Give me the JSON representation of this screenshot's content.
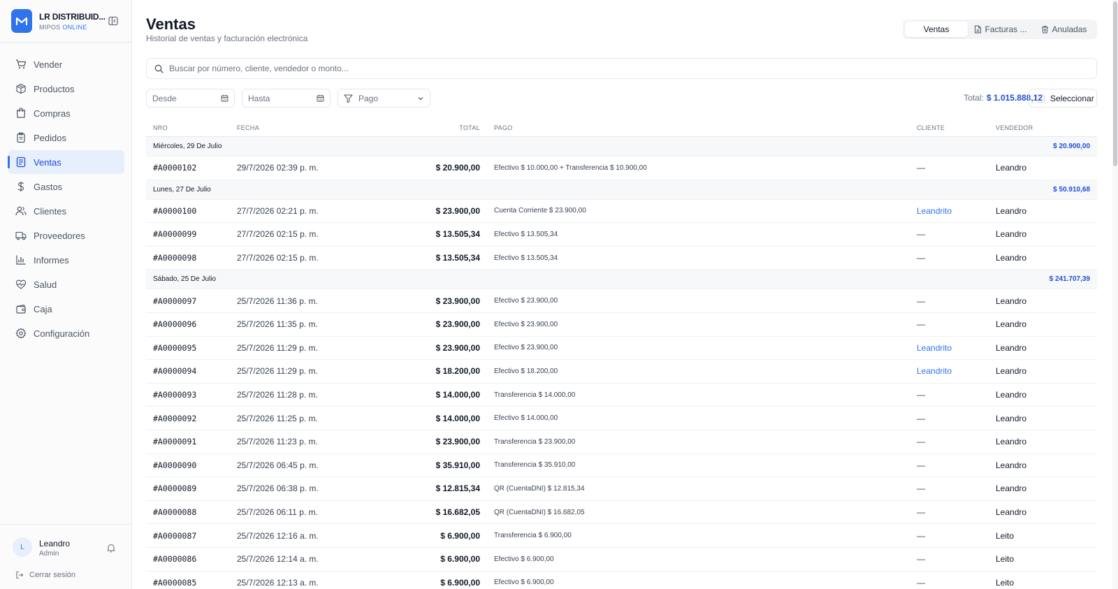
{
  "brand": {
    "name": "LR DISTRIBUID...",
    "sub_prefix": "MIPOS",
    "sub_accent": "ONLINE"
  },
  "colors": {
    "accent": "#2f74eb",
    "active_bg": "#e7eefc",
    "link": "#2f74eb"
  },
  "nav": [
    {
      "label": "Vender",
      "icon": "cart-icon"
    },
    {
      "label": "Productos",
      "icon": "box-icon"
    },
    {
      "label": "Compras",
      "icon": "bag-icon"
    },
    {
      "label": "Pedidos",
      "icon": "clipboard-icon"
    },
    {
      "label": "Ventas",
      "icon": "receipt-icon",
      "active": true
    },
    {
      "label": "Gastos",
      "icon": "dollar-icon"
    },
    {
      "label": "Clientes",
      "icon": "users-icon"
    },
    {
      "label": "Proveedores",
      "icon": "truck-icon"
    },
    {
      "label": "Informes",
      "icon": "bar-chart-icon"
    },
    {
      "label": "Salud",
      "icon": "heart-pulse-icon"
    },
    {
      "label": "Caja",
      "icon": "wallet-icon"
    },
    {
      "label": "Configuración",
      "icon": "gear-icon"
    }
  ],
  "user": {
    "initial": "L",
    "name": "Leandro",
    "role": "Admin",
    "logout": "Cerrar sesión"
  },
  "page": {
    "title": "Ventas",
    "subtitle": "Historial de ventas y facturación electrónica"
  },
  "tabs": {
    "ventas": "Ventas",
    "facturas": "Facturas ...",
    "anuladas": "Anuladas"
  },
  "search": {
    "placeholder": "Buscar por número, cliente, vendedor o monto..."
  },
  "filters": {
    "desde": "Desde",
    "hasta": "Hasta",
    "pago": "Pago"
  },
  "summary": {
    "total_label": "Total:",
    "total_value": "$ 1.015.888,12",
    "select_label": "Seleccionar"
  },
  "columns": {
    "nro": "NRO",
    "fecha": "FECHA",
    "total": "TOTAL",
    "pago": "PAGO",
    "cliente": "CLIENTE",
    "vendedor": "VENDEDOR"
  },
  "groups": [
    {
      "date": "Miércoles, 29 De Julio",
      "total": "$ 20.900,00",
      "rows": [
        {
          "nro": "#A0000102",
          "fecha": "29/7/2026 02:39 p. m.",
          "total": "$ 20.900,00",
          "pago": "Efectivo $ 10.000,00 + Transferencia $ 10.900,00",
          "cliente": "—",
          "vendedor": "Leandro"
        }
      ]
    },
    {
      "date": "Lunes, 27 De Julio",
      "total": "$ 50.910,68",
      "rows": [
        {
          "nro": "#A0000100",
          "fecha": "27/7/2026 02:21 p. m.",
          "total": "$ 23.900,00",
          "pago": "Cuenta Corriente $ 23.900,00",
          "cliente": "Leandrito",
          "vendedor": "Leandro"
        },
        {
          "nro": "#A0000099",
          "fecha": "27/7/2026 02:15 p. m.",
          "total": "$ 13.505,34",
          "pago": "Efectivo $ 13.505,34",
          "cliente": "—",
          "vendedor": "Leandro"
        },
        {
          "nro": "#A0000098",
          "fecha": "27/7/2026 02:15 p. m.",
          "total": "$ 13.505,34",
          "pago": "Efectivo $ 13.505,34",
          "cliente": "—",
          "vendedor": "Leandro"
        }
      ]
    },
    {
      "date": "Sábado, 25 De Julio",
      "total": "$ 241.707,39",
      "rows": [
        {
          "nro": "#A0000097",
          "fecha": "25/7/2026 11:36 p. m.",
          "total": "$ 23.900,00",
          "pago": "Efectivo $ 23.900,00",
          "cliente": "—",
          "vendedor": "Leandro"
        },
        {
          "nro": "#A0000096",
          "fecha": "25/7/2026 11:35 p. m.",
          "total": "$ 23.900,00",
          "pago": "Efectivo $ 23.900,00",
          "cliente": "—",
          "vendedor": "Leandro"
        },
        {
          "nro": "#A0000095",
          "fecha": "25/7/2026 11:29 p. m.",
          "total": "$ 23.900,00",
          "pago": "Efectivo $ 23.900,00",
          "cliente": "Leandrito",
          "vendedor": "Leandro"
        },
        {
          "nro": "#A0000094",
          "fecha": "25/7/2026 11:29 p. m.",
          "total": "$ 18.200,00",
          "pago": "Efectivo $ 18.200,00",
          "cliente": "Leandrito",
          "vendedor": "Leandro"
        },
        {
          "nro": "#A0000093",
          "fecha": "25/7/2026 11:28 p. m.",
          "total": "$ 14.000,00",
          "pago": "Transferencia $ 14.000,00",
          "cliente": "—",
          "vendedor": "Leandro"
        },
        {
          "nro": "#A0000092",
          "fecha": "25/7/2026 11:25 p. m.",
          "total": "$ 14.000,00",
          "pago": "Efectivo $ 14.000,00",
          "cliente": "—",
          "vendedor": "Leandro"
        },
        {
          "nro": "#A0000091",
          "fecha": "25/7/2026 11:23 p. m.",
          "total": "$ 23.900,00",
          "pago": "Transferencia $ 23.900,00",
          "cliente": "—",
          "vendedor": "Leandro"
        },
        {
          "nro": "#A0000090",
          "fecha": "25/7/2026 06:45 p. m.",
          "total": "$ 35.910,00",
          "pago": "Transferencia $ 35.910,00",
          "cliente": "—",
          "vendedor": "Leandro"
        },
        {
          "nro": "#A0000089",
          "fecha": "25/7/2026 06:38 p. m.",
          "total": "$ 12.815,34",
          "pago": "QR (CuentaDNI) $ 12.815,34",
          "cliente": "—",
          "vendedor": "Leandro"
        },
        {
          "nro": "#A0000088",
          "fecha": "25/7/2026 06:11 p. m.",
          "total": "$ 16.682,05",
          "pago": "QR (CuentaDNI) $ 16.682,05",
          "cliente": "—",
          "vendedor": "Leandro"
        },
        {
          "nro": "#A0000087",
          "fecha": "25/7/2026 12:16 a. m.",
          "total": "$ 6.900,00",
          "pago": "Transferencia $ 6.900,00",
          "cliente": "—",
          "vendedor": "Leito"
        },
        {
          "nro": "#A0000086",
          "fecha": "25/7/2026 12:14 a. m.",
          "total": "$ 6.900,00",
          "pago": "Efectivo $ 6.900,00",
          "cliente": "—",
          "vendedor": "Leito"
        },
        {
          "nro": "#A0000085",
          "fecha": "25/7/2026 12:13 a. m.",
          "total": "$ 6.900,00",
          "pago": "Efectivo $ 6.900,00",
          "cliente": "—",
          "vendedor": "Leito"
        }
      ]
    }
  ]
}
